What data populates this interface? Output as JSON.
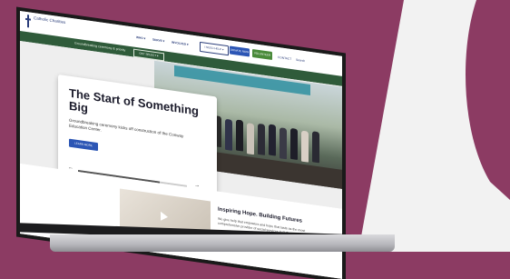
{
  "colors": {
    "background": "#8c3b63",
    "right_panel": "#f2f2f2",
    "brand_blue": "#2a3d7a",
    "subbar_green": "#2f5b3a",
    "accent_blue": "#2c56b5"
  },
  "header": {
    "logo_text": "Catholic Charities",
    "nav": [
      "WHO ▾",
      "SERVE ▾",
      "INVOLVED ▾"
    ],
    "buttons": [
      "I NEED HELP ▾",
      "DONATE NOW",
      "VOLUNTEER"
    ],
    "utility": [
      "CONTACT",
      "Search"
    ]
  },
  "subbar": {
    "text": "Groundbreaking ceremony & priority",
    "button": "GET SELECT ▾"
  },
  "hero": {
    "title": "The Start of Something Big",
    "body": "Groundbreaking ceremony kicks off construction of the Conway Education Center.",
    "button": "LEARN MORE",
    "progress_fraction": 0.75
  },
  "section": {
    "title": "Inspiring Hope. Building Futures",
    "body": "We give help that empowers and hope that lasts as the most comprehensive provider of social services in D.C. and suburban Maryland."
  }
}
